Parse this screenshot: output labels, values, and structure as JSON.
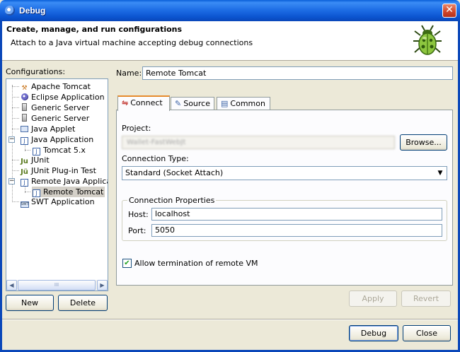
{
  "window": {
    "title": "Debug",
    "close_glyph": "✕"
  },
  "header": {
    "title": "Create, manage, and run configurations",
    "subtitle": "Attach to a Java virtual machine accepting debug connections",
    "icon": "bug-icon"
  },
  "configurations": {
    "label": "Configurations:",
    "items": [
      {
        "label": "Apache Tomcat",
        "icon": "tomcat-icon"
      },
      {
        "label": "Eclipse Application",
        "icon": "eclipse-icon"
      },
      {
        "label": "Generic Server",
        "icon": "server-icon"
      },
      {
        "label": "Generic Server",
        "icon": "server-icon"
      },
      {
        "label": "Java Applet",
        "icon": "applet-icon"
      },
      {
        "label": "Java Application",
        "icon": "java-app-icon"
      },
      {
        "label": "Tomcat 5.x",
        "icon": "java-app-icon"
      },
      {
        "label": "JUnit",
        "icon": "junit-icon"
      },
      {
        "label": "JUnit Plug-in Test",
        "icon": "junit-plugin-icon"
      },
      {
        "label": "Remote Java Applicat",
        "icon": "remote-java-icon"
      },
      {
        "label": "Remote Tomcat",
        "icon": "remote-java-icon"
      },
      {
        "label": "SWT Application",
        "icon": "swt-icon"
      }
    ],
    "scroll_thumb_grip": "III",
    "new_button": "New",
    "delete_button": "Delete"
  },
  "name_field": {
    "label": "Name:",
    "value": "Remote Tomcat"
  },
  "tabs": [
    {
      "label": "Connect",
      "icon": "connect-icon",
      "active": true
    },
    {
      "label": "Source",
      "icon": "source-icon",
      "active": false
    },
    {
      "label": "Common",
      "icon": "common-icon",
      "active": false
    }
  ],
  "connect_tab": {
    "project_label": "Project:",
    "project_value": "Wallet-FastWebJt",
    "browse_button": "Browse...",
    "connection_type_label": "Connection Type:",
    "connection_type_value": "Standard (Socket Attach)",
    "connection_props_legend": "Connection Properties",
    "host_label": "Host:",
    "host_value": "localhost",
    "port_label": "Port:",
    "port_value": "5050",
    "allow_termination_label": "Allow termination of remote VM",
    "allow_termination_checked": true
  },
  "actions": {
    "apply": "Apply",
    "revert": "Revert",
    "debug": "Debug",
    "close": "Close"
  },
  "colors": {
    "titlebar": "#0a5fd8",
    "dialog_bg": "#ece9d8",
    "tab_accent": "#e68b2c"
  }
}
